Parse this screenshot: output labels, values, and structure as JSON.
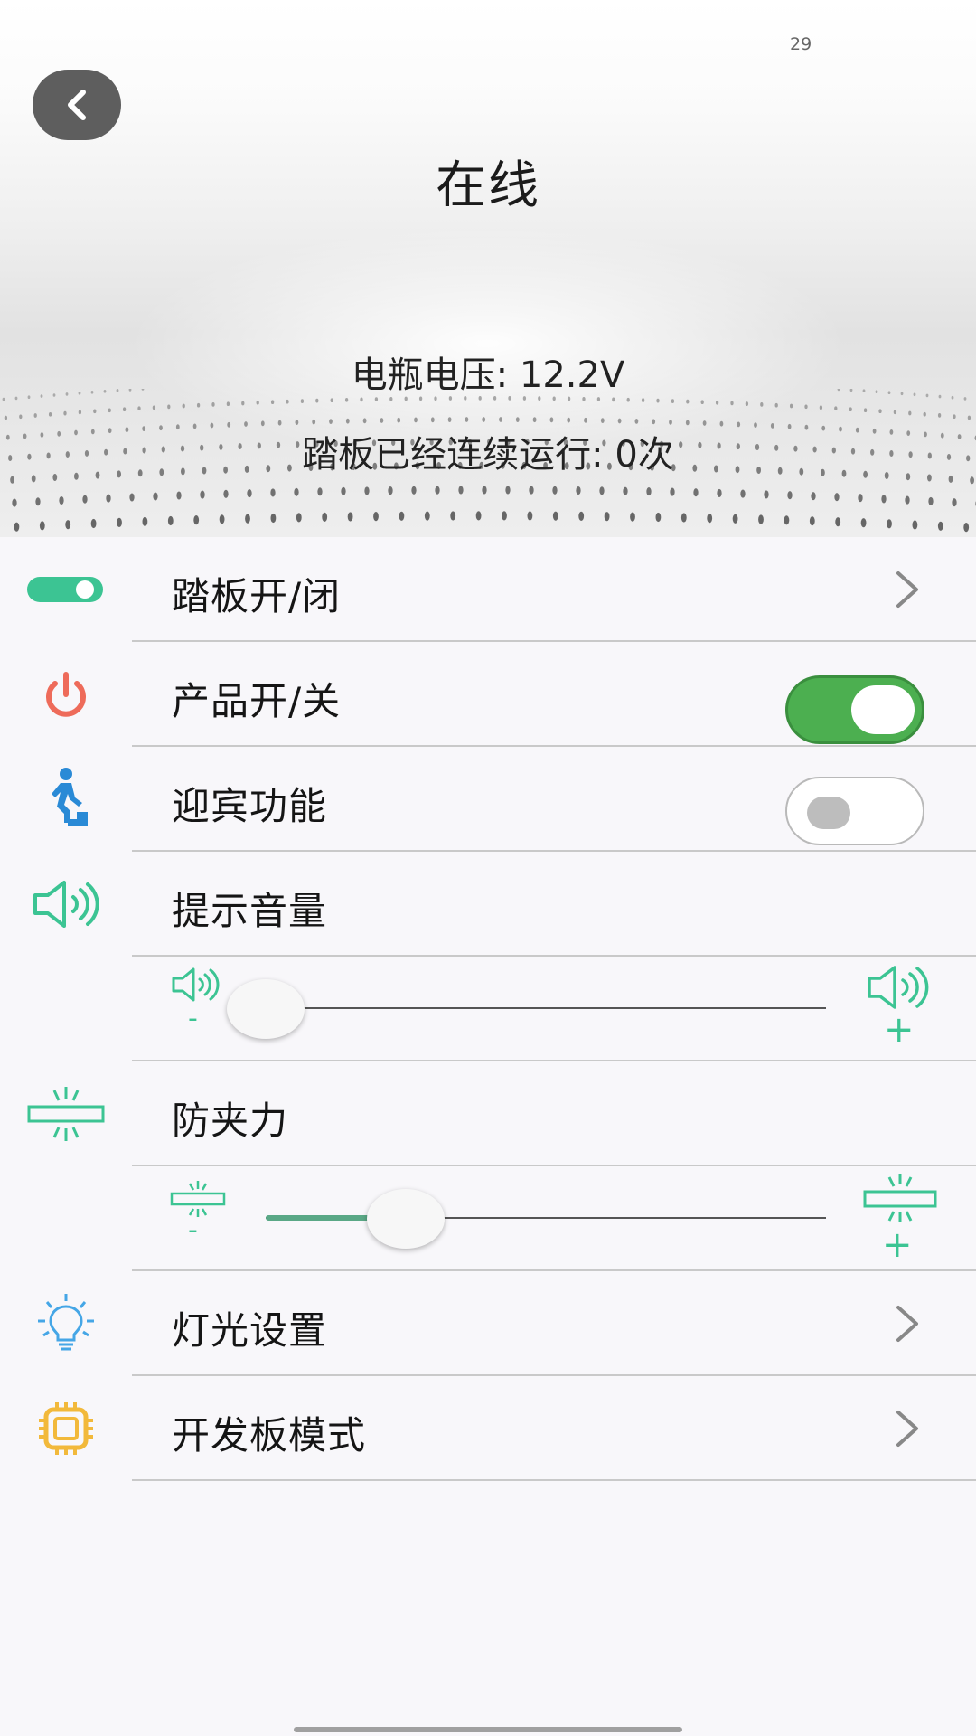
{
  "status_bar": {
    "number": "29"
  },
  "header": {
    "title": "在线",
    "battery_voltage": "电瓶电压: 12.2V",
    "run_count": "踏板已经连续运行: 0次"
  },
  "settings": {
    "pedal_toggle": {
      "label": "踏板开/闭"
    },
    "product_power": {
      "label": "产品开/关",
      "enabled": true
    },
    "welcome": {
      "label": "迎宾功能",
      "enabled": false
    },
    "volume": {
      "label": "提示音量",
      "level": 0.0,
      "minus_symbol": "-",
      "plus_symbol": "+"
    },
    "anti_pinch": {
      "label": "防夹力",
      "level": 0.25,
      "minus_symbol": "-",
      "plus_symbol": "+"
    },
    "light_settings": {
      "label": "灯光设置"
    },
    "dev_board_mode": {
      "label": "开发板模式"
    }
  },
  "icons": {
    "back": "chevron-left-icon",
    "pedal_toggle": "toggle-switch-icon",
    "product_power": "power-icon",
    "welcome": "person-on-step-icon",
    "volume": "speaker-icon",
    "anti_pinch": "pinch-force-icon",
    "light_settings": "lightbulb-icon",
    "dev_board_mode": "chip-icon",
    "chevron": "chevron-right-icon"
  },
  "colors": {
    "accent_green": "#4caf50",
    "icon_green": "#3cc493",
    "power_red": "#ee6b5a",
    "walker_blue": "#2a8ad6",
    "bulb_blue": "#45a6e6",
    "chip_yellow": "#f2b93b",
    "back_button": "#5e5e5e"
  }
}
